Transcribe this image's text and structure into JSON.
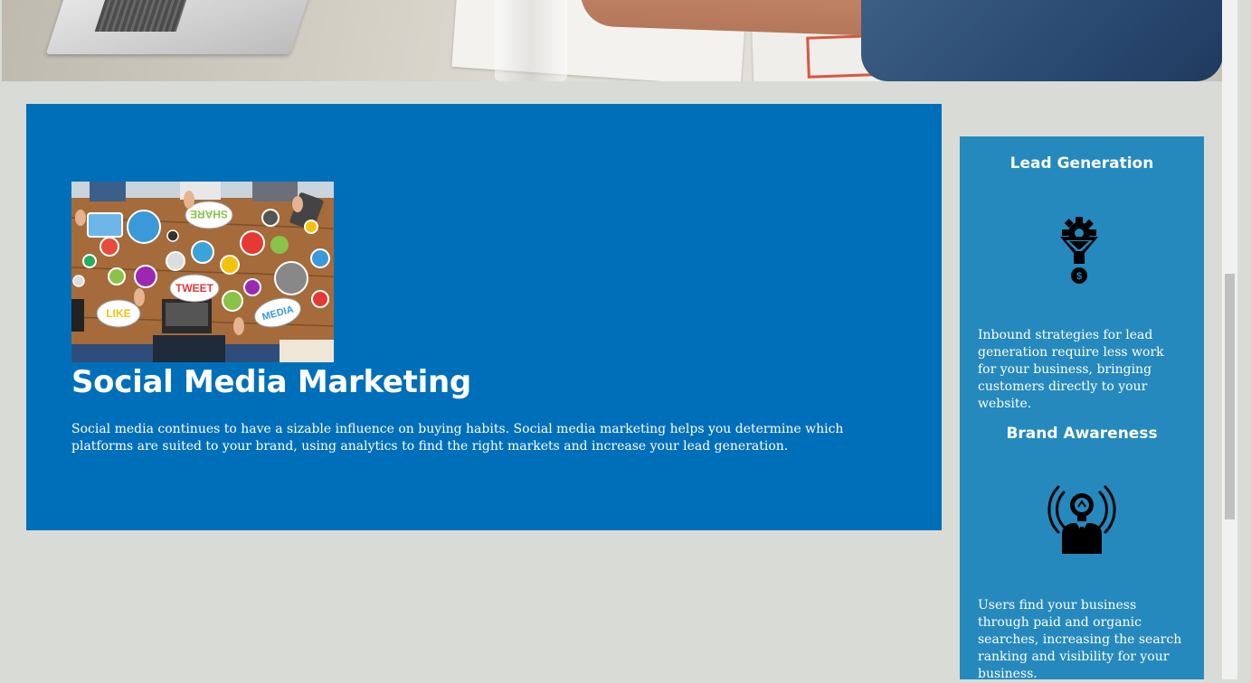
{
  "main_panel": {
    "title": "Social Media Marketing",
    "description": "Social media continues to have a sizable influence on buying habits. Social media marketing helps you determine which platforms are suited to your brand, using analytics to find the right markets and increase your lead generation.",
    "image_words": [
      "SHARE",
      "TWEET",
      "LIKE",
      "MEDIA"
    ]
  },
  "sidebar": {
    "items": [
      {
        "title": "Lead Generation",
        "icon": "lead-generation-icon",
        "text": "Inbound strategies for lead generation require less work for your business, bringing customers directly to your website."
      },
      {
        "title": "Brand Awareness",
        "icon": "brand-awareness-icon",
        "text": "Users find your business through paid and organic searches, increasing the search ranking and visibility for your business."
      }
    ]
  },
  "colors": {
    "page_background": "#d9dcd6",
    "main_panel": "#006fba",
    "sidebar": "#2589bd",
    "text": "#ffffff"
  }
}
